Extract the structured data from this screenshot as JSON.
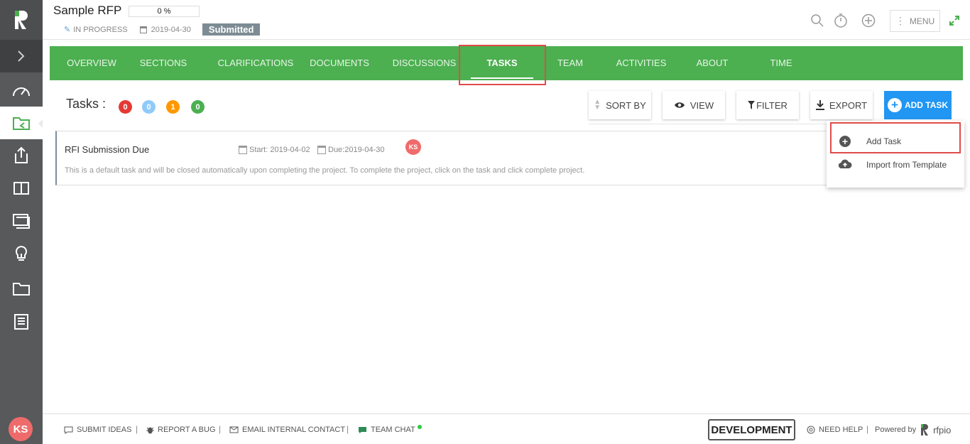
{
  "project": {
    "title": "Sample RFP",
    "progress": "0 %",
    "status": "IN PROGRESS",
    "due_date": "2019-04-30",
    "badge": "Submitted"
  },
  "header": {
    "menu_label": "MENU"
  },
  "tabs": [
    {
      "label": "OVERVIEW"
    },
    {
      "label": "SECTIONS"
    },
    {
      "label": "CLARIFICATIONS"
    },
    {
      "label": "DOCUMENTS"
    },
    {
      "label": "DISCUSSIONS"
    },
    {
      "label": "TASKS",
      "active": true
    },
    {
      "label": "TEAM"
    },
    {
      "label": "ACTIVITIES"
    },
    {
      "label": "ABOUT"
    },
    {
      "label": "TIME"
    }
  ],
  "toolbar": {
    "tasks_label": "Tasks :",
    "counts": [
      {
        "value": "0",
        "color": "#e53935"
      },
      {
        "value": "0",
        "color": "#90caf9"
      },
      {
        "value": "1",
        "color": "#ff9800"
      },
      {
        "value": "0",
        "color": "#4caf50"
      }
    ],
    "sort_label": "SORT BY",
    "view_label": "VIEW",
    "filter_label": "FILTER",
    "export_label": "EXPORT",
    "add_label": "ADD TASK"
  },
  "task": {
    "title": "RFI Submission Due",
    "start": "Start: 2019-04-02",
    "due": "Due:2019-04-30",
    "assignee_initials": "KS",
    "description": "This is a default task and will be closed automatically upon completing the project. To complete the project, click on the task and click complete project."
  },
  "dropdown": {
    "items": [
      {
        "label": "Add Task",
        "icon": "plus-circle-icon"
      },
      {
        "label": "Import from Template",
        "icon": "cloud-upload-icon"
      }
    ]
  },
  "sidebar": {
    "user_initials": "KS",
    "items": [
      "dashboard-icon",
      "projects-icon",
      "export-icon",
      "library-icon",
      "documents-icon",
      "ideas-icon",
      "folder-icon",
      "reports-icon"
    ]
  },
  "footer": {
    "submit_ideas": "SUBMIT IDEAS",
    "report_bug": "REPORT A BUG",
    "email_contact": "EMAIL INTERNAL CONTACT",
    "team_chat": "TEAM CHAT",
    "environment": "DEVELOPMENT",
    "need_help": "NEED HELP",
    "powered_by": "Powered by",
    "brand": "rfpio"
  },
  "colors": {
    "accent_green": "#4caf50",
    "primary_blue": "#2196f3",
    "sidebar_bg": "#58595b",
    "highlight_red": "#e04b4b"
  }
}
